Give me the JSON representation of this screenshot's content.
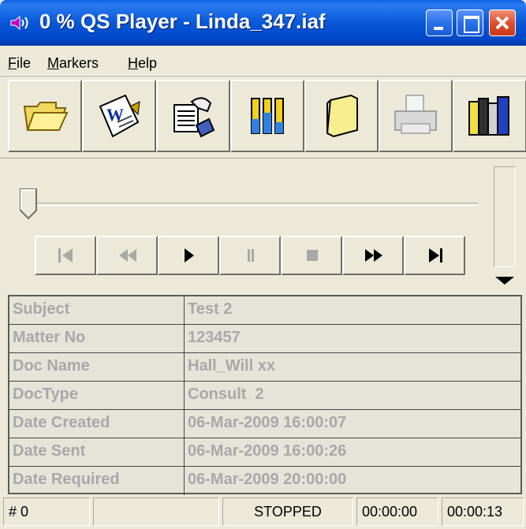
{
  "window": {
    "title": "0 % QS Player - Linda_347.iaf",
    "icon": "speaker-icon"
  },
  "menu": {
    "items": [
      {
        "label": "File"
      },
      {
        "label": "Markers"
      },
      {
        "label": "Help"
      }
    ]
  },
  "toolbar": {
    "buttons": [
      {
        "icon": "open-folder-icon"
      },
      {
        "icon": "word-document-icon"
      },
      {
        "icon": "typing-hands-icon"
      },
      {
        "icon": "level-meters-icon"
      },
      {
        "icon": "folder-icon"
      },
      {
        "icon": "printer-disabled-icon"
      },
      {
        "icon": "books-icon"
      }
    ]
  },
  "player": {
    "position_fraction": 0,
    "transport": [
      {
        "icon": "skip-start-icon",
        "enabled": false
      },
      {
        "icon": "rewind-icon",
        "enabled": false
      },
      {
        "icon": "play-icon",
        "enabled": true
      },
      {
        "icon": "pause-icon",
        "enabled": false
      },
      {
        "icon": "stop-icon",
        "enabled": false
      },
      {
        "icon": "fast-forward-icon",
        "enabled": true
      },
      {
        "icon": "skip-end-icon",
        "enabled": true
      }
    ]
  },
  "details": [
    {
      "key": "Subject",
      "value": "Test 2"
    },
    {
      "key": "Matter No",
      "value": "123457"
    },
    {
      "key": "Doc Name",
      "value": "Hall_Will xx"
    },
    {
      "key": "DocType",
      "value": "Consult  2"
    },
    {
      "key": "Date Created",
      "value": "06-Mar-2009 16:00:07"
    },
    {
      "key": "Date Sent",
      "value": "06-Mar-2009 16:00:26"
    },
    {
      "key": "Date Required",
      "value": "06-Mar-2009 20:00:00"
    }
  ],
  "status": {
    "marker": "# 0",
    "blank": "",
    "state": "STOPPED",
    "position": "00:00:00",
    "duration": "00:00:13"
  }
}
